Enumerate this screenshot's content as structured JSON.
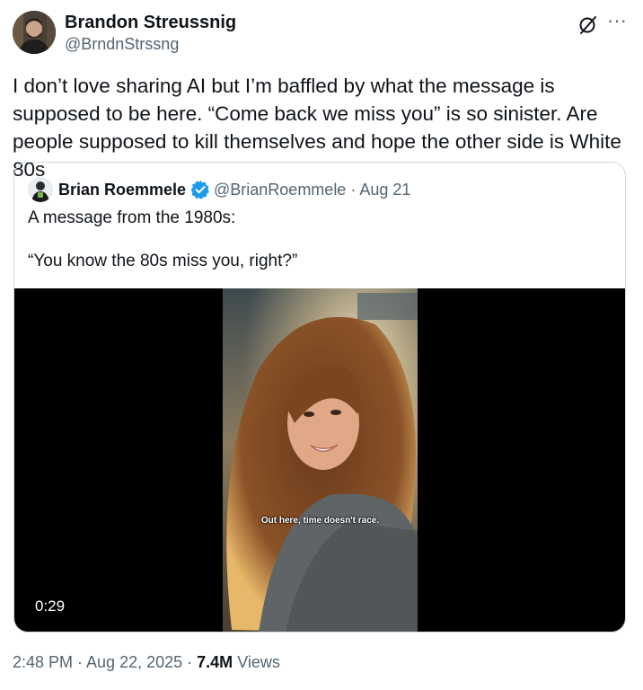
{
  "tweet": {
    "author": {
      "display_name": "Brandon Streussnig",
      "handle": "@BrndnStrssng",
      "avatar_icon": "user-avatar"
    },
    "text": "I don’t love sharing AI but I’m baffled by what the message is supposed to be here. “Come back we miss you” is so sinister. Are people supposed to kill themselves and hope the other side is White 80s",
    "actions": {
      "grok_icon": "grok-icon",
      "more_icon": "more-icon",
      "more_glyph": "···"
    },
    "timestamp": "2:48 PM · Aug 22, 2025",
    "separator": " · ",
    "views_count": "7.4M",
    "views_label": "Views"
  },
  "quoted_tweet": {
    "author": {
      "display_name": "Brian Roemmele",
      "handle": "@BrianRoemmele",
      "date": "Aug 21",
      "verified": true
    },
    "meta": "@BrianRoemmele · Aug 21",
    "text": "A message from the 1980s:\n\n“You know the 80s miss you, right?”",
    "video": {
      "caption": "Out here, time doesn't race.",
      "duration": "0:29"
    }
  },
  "colors": {
    "text_primary": "#0f1419",
    "text_secondary": "#536471",
    "border": "#cfd9de",
    "verified_blue": "#1d9bf0"
  }
}
